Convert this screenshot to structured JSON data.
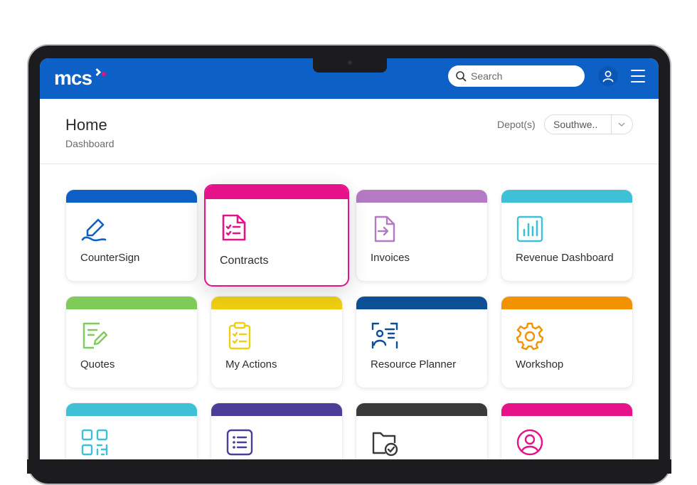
{
  "app": {
    "logo_text": "mcs"
  },
  "search": {
    "placeholder": "Search"
  },
  "header": {
    "title": "Home",
    "subtitle": "Dashboard",
    "depot_label": "Depot(s)",
    "depot_value": "Southwe.."
  },
  "tiles": [
    {
      "label": "CounterSign",
      "color": "#0d61c6",
      "icon": "signature-icon"
    },
    {
      "label": "Contracts",
      "color": "#e5128a",
      "icon": "contract-checklist-icon"
    },
    {
      "label": "Invoices",
      "color": "#b57ac4",
      "icon": "invoice-import-icon"
    },
    {
      "label": "Revenue Dashboard",
      "color": "#3ec1d6",
      "icon": "bar-chart-icon"
    },
    {
      "label": "Quotes",
      "color": "#7ecb5a",
      "icon": "edit-document-icon"
    },
    {
      "label": "My Actions",
      "color": "#f0cf12",
      "icon": "clipboard-checklist-icon"
    },
    {
      "label": "Resource Planner",
      "color": "#0c4f94",
      "icon": "person-card-icon"
    },
    {
      "label": "Workshop",
      "color": "#f39200",
      "icon": "gear-icon"
    },
    {
      "label": "",
      "color": "#3ec1d6",
      "icon": "qr-code-icon"
    },
    {
      "label": "",
      "color": "#4c3d96",
      "icon": "list-icon"
    },
    {
      "label": "",
      "color": "#3a3a3a",
      "icon": "folder-check-icon"
    },
    {
      "label": "",
      "color": "#e5128a",
      "icon": "user-circle-icon"
    }
  ]
}
